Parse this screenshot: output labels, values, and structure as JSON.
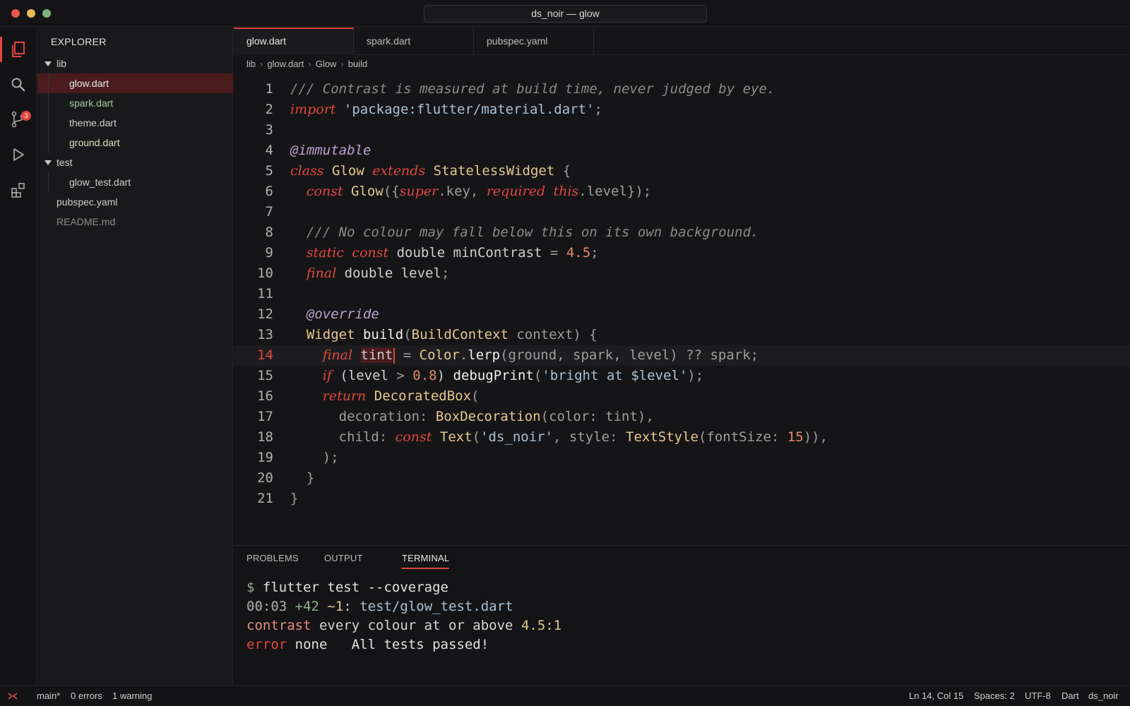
{
  "window": {
    "title": "ds_noir — glow"
  },
  "activity": {
    "scm_badge": "3"
  },
  "sidebar": {
    "title": "EXPLORER",
    "tree": [
      {
        "label": "lib",
        "type": "folder"
      },
      {
        "label": "glow.dart",
        "type": "file"
      },
      {
        "label": "spark.dart",
        "type": "file"
      },
      {
        "label": "theme.dart",
        "type": "file"
      },
      {
        "label": "ground.dart",
        "type": "file"
      },
      {
        "label": "test",
        "type": "folder"
      },
      {
        "label": "glow_test.dart",
        "type": "file"
      },
      {
        "label": "pubspec.yaml",
        "type": "file"
      },
      {
        "label": "README.md",
        "type": "file"
      }
    ]
  },
  "tabs": [
    {
      "label": "glow.dart"
    },
    {
      "label": "spark.dart"
    },
    {
      "label": "pubspec.yaml"
    }
  ],
  "breadcrumb": [
    "lib",
    "glow.dart",
    "Glow",
    "build"
  ],
  "editor": {
    "current_line": "14",
    "lines": [
      [
        {
          "t": "/// Contrast is measured at build time, never judged by eye.",
          "c": "cm"
        }
      ],
      [
        {
          "t": "import",
          "c": "kw"
        },
        {
          "t": " "
        },
        {
          "t": "'package:flutter/material.dart'",
          "c": "st"
        },
        {
          "t": ";",
          "c": "pr"
        }
      ],
      [],
      [
        {
          "t": "@immutable",
          "c": "an"
        }
      ],
      [
        {
          "t": "class",
          "c": "kw"
        },
        {
          "t": " "
        },
        {
          "t": "Glow",
          "c": "ty"
        },
        {
          "t": " "
        },
        {
          "t": "extends",
          "c": "kw"
        },
        {
          "t": " "
        },
        {
          "t": "StatelessWidget",
          "c": "ty"
        },
        {
          "t": " {",
          "c": "pr"
        }
      ],
      [
        {
          "t": "  "
        },
        {
          "t": "const",
          "c": "kw"
        },
        {
          "t": " "
        },
        {
          "t": "Glow",
          "c": "ty"
        },
        {
          "t": "({",
          "c": "pr"
        },
        {
          "t": "super",
          "c": "kw"
        },
        {
          "t": ".key, ",
          "c": "pr"
        },
        {
          "t": "required",
          "c": "kw"
        },
        {
          "t": " "
        },
        {
          "t": "this",
          "c": "kw"
        },
        {
          "t": ".level});",
          "c": "pr"
        }
      ],
      [],
      [
        {
          "t": "  "
        },
        {
          "t": "/// No colour may fall below this on its own background.",
          "c": "cm"
        }
      ],
      [
        {
          "t": "  "
        },
        {
          "t": "static",
          "c": "kw"
        },
        {
          "t": " "
        },
        {
          "t": "const",
          "c": "kw"
        },
        {
          "t": " double minContrast "
        },
        {
          "t": "=",
          "c": "pr"
        },
        {
          "t": " "
        },
        {
          "t": "4.5",
          "c": "nu"
        },
        {
          "t": ";",
          "c": "pr"
        }
      ],
      [
        {
          "t": "  "
        },
        {
          "t": "final",
          "c": "kw"
        },
        {
          "t": " double level"
        },
        {
          "t": ";",
          "c": "pr"
        }
      ],
      [],
      [
        {
          "t": "  "
        },
        {
          "t": "@override",
          "c": "an"
        }
      ],
      [
        {
          "t": "  "
        },
        {
          "t": "Widget",
          "c": "ty"
        },
        {
          "t": " "
        },
        {
          "t": "build",
          "c": "fn"
        },
        {
          "t": "(",
          "c": "pr"
        },
        {
          "t": "BuildContext",
          "c": "ty"
        },
        {
          "t": " context) {",
          "c": "pr"
        }
      ],
      [
        {
          "t": "    "
        },
        {
          "t": "final",
          "c": "kw"
        },
        {
          "t": " "
        },
        {
          "t": "tint",
          "c": "hl"
        },
        {
          "t": "",
          "c": "cursor"
        },
        {
          "t": " = ",
          "c": "pr"
        },
        {
          "t": "Color",
          "c": "ty"
        },
        {
          "t": ".",
          "c": "pr"
        },
        {
          "t": "lerp",
          "c": "fn"
        },
        {
          "t": "(ground, spark, level) ?? spark;",
          "c": "pr"
        }
      ],
      [
        {
          "t": "    "
        },
        {
          "t": "if",
          "c": "kw"
        },
        {
          "t": " (level "
        },
        {
          "t": ">",
          "c": "pr"
        },
        {
          "t": " "
        },
        {
          "t": "0.8",
          "c": "nu"
        },
        {
          "t": ") "
        },
        {
          "t": "debugPrint",
          "c": "fn"
        },
        {
          "t": "(",
          "c": "pr"
        },
        {
          "t": "'bright at $level'",
          "c": "st"
        },
        {
          "t": ");",
          "c": "pr"
        }
      ],
      [
        {
          "t": "    "
        },
        {
          "t": "return",
          "c": "kw"
        },
        {
          "t": " "
        },
        {
          "t": "DecoratedBox",
          "c": "ty"
        },
        {
          "t": "(",
          "c": "pr"
        }
      ],
      [
        {
          "t": "      decoration: ",
          "c": "pr"
        },
        {
          "t": "BoxDecoration",
          "c": "ty"
        },
        {
          "t": "(color: tint),",
          "c": "pr"
        }
      ],
      [
        {
          "t": "      child: ",
          "c": "pr"
        },
        {
          "t": "const",
          "c": "kw"
        },
        {
          "t": " "
        },
        {
          "t": "Text",
          "c": "ty"
        },
        {
          "t": "(",
          "c": "pr"
        },
        {
          "t": "'ds_noir'",
          "c": "st"
        },
        {
          "t": ", style: ",
          "c": "pr"
        },
        {
          "t": "TextStyle",
          "c": "ty"
        },
        {
          "t": "(fontSize: ",
          "c": "pr"
        },
        {
          "t": "15",
          "c": "nu"
        },
        {
          "t": ")),",
          "c": "pr"
        }
      ],
      [
        {
          "t": "    );",
          "c": "pr"
        }
      ],
      [
        {
          "t": "  }",
          "c": "pr"
        }
      ],
      [
        {
          "t": "}",
          "c": "pr"
        }
      ]
    ]
  },
  "panel": {
    "tabs": [
      "PROBLEMS",
      "OUTPUT",
      "TERMINAL"
    ],
    "terminal": [
      [
        {
          "t": "$ ",
          "c": "#8fb08c"
        },
        {
          "t": "flutter test --coverage",
          "c": "#e2e2e2"
        }
      ],
      [
        {
          "t": "00:03 ",
          "c": "#b0b0b0"
        },
        {
          "t": "+42",
          "c": "#8fb08c"
        },
        {
          "t": " "
        },
        {
          "t": "~1",
          "c": "#e5c88e"
        },
        {
          "t": ": "
        },
        {
          "t": "test/glow_test.dart",
          "c": "#a9c1d6"
        }
      ],
      [
        {
          "t": "contrast",
          "c": "#e88a84"
        },
        {
          "t": " every colour at or above "
        },
        {
          "t": "4.5:1",
          "c": "#e5c88e"
        }
      ],
      [
        {
          "t": "error",
          "c": "#e0473f"
        },
        {
          "t": " none   All tests passed!",
          "c": "#e2e2e2"
        }
      ]
    ]
  },
  "status": {
    "branch": "main*",
    "errors": "0 errors",
    "warnings": "1 warning",
    "position": "Ln 14, Col 15",
    "spaces": "Spaces: 2",
    "encoding": "UTF-8",
    "language": "Dart",
    "theme": "ds_noir"
  },
  "colors": {
    "accent": "#e0473f",
    "background": "#151517",
    "selection": "#4a1c1d"
  },
  "icons": [
    "files-icon",
    "search-icon",
    "source-control-icon",
    "run-icon",
    "extensions-icon",
    "remote-icon"
  ]
}
